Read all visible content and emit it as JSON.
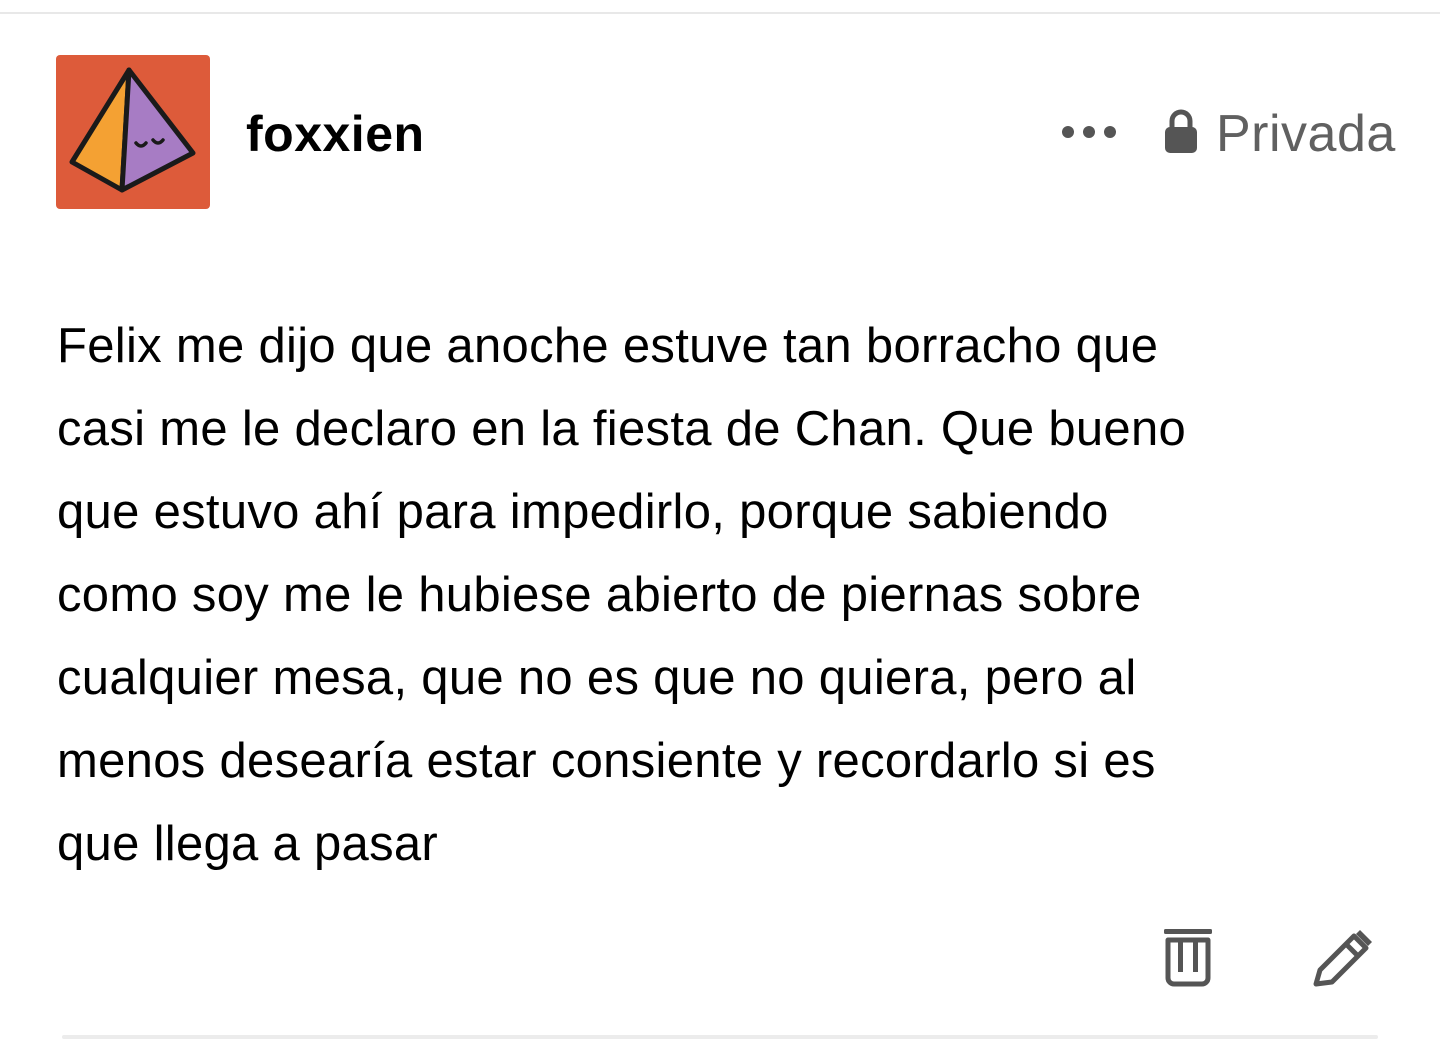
{
  "post": {
    "author": {
      "username": "foxxien",
      "avatar_icon": "pyramid-avatar-icon",
      "avatar_bg": "#dd5b3a"
    },
    "header": {
      "more_icon": "ellipsis-icon",
      "privacy_icon": "lock-icon",
      "privacy_label": "Privada"
    },
    "body_lines": [
      "Felix me dijo que anoche estuve tan borracho que",
      "casi me le declaro en la fiesta de Chan. Que bueno",
      "que estuvo ahí para impedirlo, porque sabiendo",
      "como soy me le hubiese abierto de piernas sobre",
      "cualquier mesa, que no es que no quiera, pero al",
      "menos desearía estar consiente y recordarlo si es",
      "que llega a pasar"
    ],
    "footer": {
      "delete_icon": "trash-icon",
      "edit_icon": "pencil-icon"
    }
  },
  "colors": {
    "text": "#000000",
    "muted": "#606060",
    "divider": "#e8e8e8",
    "avatar_orange": "#f4a133",
    "avatar_purple": "#a77cc4"
  }
}
